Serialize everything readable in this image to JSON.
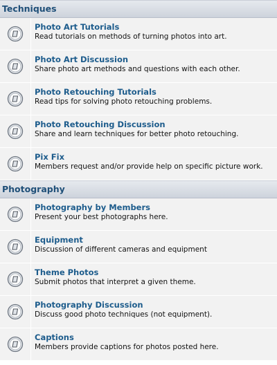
{
  "categories": [
    {
      "title": "Techniques",
      "forums": [
        {
          "title": "Photo Art Tutorials",
          "description": "Read tutorials on methods of turning photos into art.",
          "icon": "forum-read-icon"
        },
        {
          "title": "Photo Art Discussion",
          "description": "Share photo art methods and questions with each other.",
          "icon": "forum-read-icon"
        },
        {
          "title": "Photo Retouching Tutorials",
          "description": "Read tips for solving photo retouching problems.",
          "icon": "forum-read-icon"
        },
        {
          "title": "Photo Retouching Discussion",
          "description": "Share and learn techniques for better photo retouching.",
          "icon": "forum-read-icon"
        },
        {
          "title": "Pix Fix",
          "description": "Members request and/or provide help on specific picture work.",
          "icon": "forum-read-icon"
        }
      ]
    },
    {
      "title": "Photography",
      "forums": [
        {
          "title": "Photography by Members",
          "description": "Present your best photographs here.",
          "icon": "forum-read-icon"
        },
        {
          "title": "Equipment",
          "description": "Discussion of different cameras and equipment",
          "icon": "forum-read-icon"
        },
        {
          "title": "Theme Photos",
          "description": "Submit photos that interpret a given theme.",
          "icon": "forum-read-icon"
        },
        {
          "title": "Photography Discussion",
          "description": "Discuss good photo techniques (not equipment).",
          "icon": "forum-read-icon"
        },
        {
          "title": "Captions",
          "description": "Members provide captions for photos posted here.",
          "icon": "forum-read-icon"
        }
      ]
    }
  ]
}
